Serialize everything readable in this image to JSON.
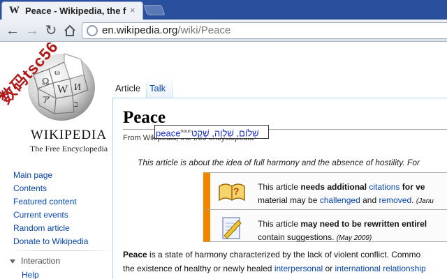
{
  "browser": {
    "tab_title": "Peace - Wikipedia, the free encyclopedia",
    "tab_close": "×",
    "url_host": "en.wikipedia.org",
    "url_path": "/wiki/Peace",
    "back_icon": "←",
    "forward_icon": "→",
    "reload_icon": "↻"
  },
  "watermark": "数码tsc56",
  "logo": {
    "wordmark": "WIKIPEDIA",
    "tagline": "The Free Encyclopedia"
  },
  "sidebar": {
    "items": [
      {
        "label": "Main page"
      },
      {
        "label": "Contents"
      },
      {
        "label": "Featured content"
      },
      {
        "label": "Current events"
      },
      {
        "label": "Random article"
      },
      {
        "label": "Donate to Wikipedia"
      }
    ],
    "section": "Interaction",
    "help": "Help"
  },
  "page_tabs": {
    "article": "Article",
    "talk": "Talk"
  },
  "article": {
    "title": "Peace",
    "from": "From Wikipedia, the free encyclopedia",
    "hatnote": "This article is about the idea of full harmony and the absence of hostility. For"
  },
  "dictionary_popup": {
    "word": "peace",
    "pos": "noun",
    "translation": "שָׁלוֹם, שַׁלְוָה, שֶׁקֶט"
  },
  "notices": [
    {
      "pre": "This article ",
      "bold": "needs additional ",
      "link": "citations",
      "post_bold": " for ve",
      "line2_pre": "material may be ",
      "line2_link1": "challenged",
      "line2_mid": " and ",
      "line2_link2": "removed",
      "line2_post": ". ",
      "date": "(Janu"
    },
    {
      "pre": "This article ",
      "bold": "may need to be rewritten entirel",
      "line2": "contain suggestions. ",
      "date": "(May 2009)"
    }
  ],
  "paragraph": {
    "line1_bold": "Peace",
    "line1": " is a state of harmony characterized by the lack of violent conflict. Commo",
    "line2_pre": "the existence of healthy or newly healed ",
    "line2_link1": "interpersonal",
    "line2_mid": " or ",
    "line2_link2": "international relationship"
  }
}
